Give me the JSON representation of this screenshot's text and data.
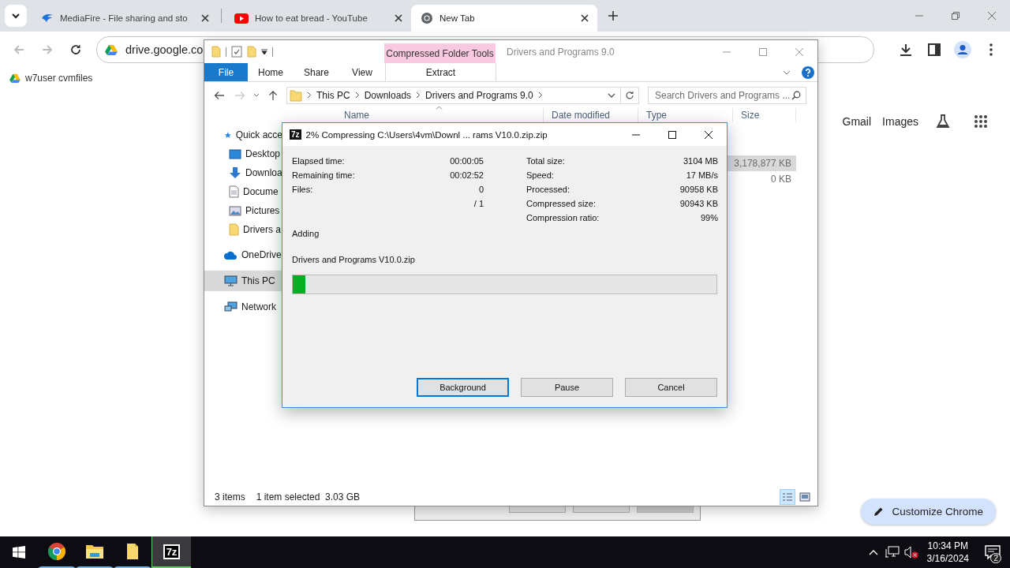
{
  "browser": {
    "tabs": [
      {
        "title": "MediaFire - File sharing and sto",
        "selected": false
      },
      {
        "title": "How to eat bread - YouTube",
        "selected": false
      },
      {
        "title": "New Tab",
        "selected": true
      }
    ],
    "address": "drive.google.co",
    "bookmarks": [
      "w7user cvmfiles"
    ],
    "page_links": [
      "Gmail",
      "Images"
    ],
    "customize_button": "Customize Chrome"
  },
  "explorer": {
    "context_tab": "Compressed Folder Tools",
    "title": "Drivers and Programs 9.0",
    "ribbon_tabs": [
      "File",
      "Home",
      "Share",
      "View"
    ],
    "context_ribbon_tab": "Extract",
    "breadcrumb": [
      "This PC",
      "Downloads",
      "Drivers and Programs 9.0"
    ],
    "search": {
      "placeholder": "Search Drivers and Programs ..."
    },
    "columns": [
      "Name",
      "Date modified",
      "Type",
      "Size"
    ],
    "nav": [
      {
        "label": "Quick acce",
        "selected": false,
        "children": [
          {
            "label": "Desktop",
            "selected": false
          },
          {
            "label": "Downloa",
            "selected": false
          },
          {
            "label": "Docume",
            "selected": false
          },
          {
            "label": "Pictures",
            "selected": false
          },
          {
            "label": "Drivers a",
            "selected": false
          }
        ]
      },
      {
        "label": "OneDrive",
        "selected": false
      },
      {
        "label": "This PC",
        "selected": true
      },
      {
        "label": "Network",
        "selected": false
      }
    ],
    "rows": [
      {
        "size": "3,178,877 KB",
        "selected": true
      },
      {
        "size": "0 KB",
        "selected": false
      }
    ],
    "status": {
      "count": "3 items",
      "selection": "1 item selected  3.03 GB"
    },
    "view_modes": [
      {
        "kind": "details",
        "selected": true
      },
      {
        "kind": "thumbnails",
        "selected": false
      }
    ]
  },
  "dialog": {
    "icon_text": "7z",
    "title": "2% Compressing C:\\Users\\4vm\\Downl ... rams V10.0.zip.zip",
    "left_stats": [
      {
        "label": "Elapsed time:",
        "value": "00:00:05"
      },
      {
        "label": "Remaining time:",
        "value": "00:02:52"
      },
      {
        "label": "Files:",
        "value": "0"
      },
      {
        "value": "/ 1"
      }
    ],
    "right_stats": [
      {
        "label": "Total size:",
        "value": "3104 MB"
      },
      {
        "label": "Speed:",
        "value": "17 MB/s"
      },
      {
        "label": "Processed:",
        "value": "90958 KB"
      },
      {
        "label": "Compressed size:",
        "value": "90943 KB"
      },
      {
        "label": "Compression ratio:",
        "value": "99%"
      }
    ],
    "operation": "Adding",
    "file": "Drivers and Programs V10.0.zip",
    "level": 0.03,
    "buttons": [
      {
        "label": "Background",
        "focused": true
      },
      {
        "label": "Pause",
        "focused": false
      },
      {
        "label": "Cancel",
        "focused": false
      }
    ]
  },
  "taskbar": {
    "apps": [
      {
        "kind": "chrome",
        "active": false
      },
      {
        "kind": "explorer",
        "active": false
      },
      {
        "kind": "folder",
        "active": false
      },
      {
        "kind": "sevenzip",
        "label": "7z",
        "active": true
      }
    ],
    "time": "10:34 PM",
    "date": "3/16/2024",
    "notifications": "2"
  }
}
